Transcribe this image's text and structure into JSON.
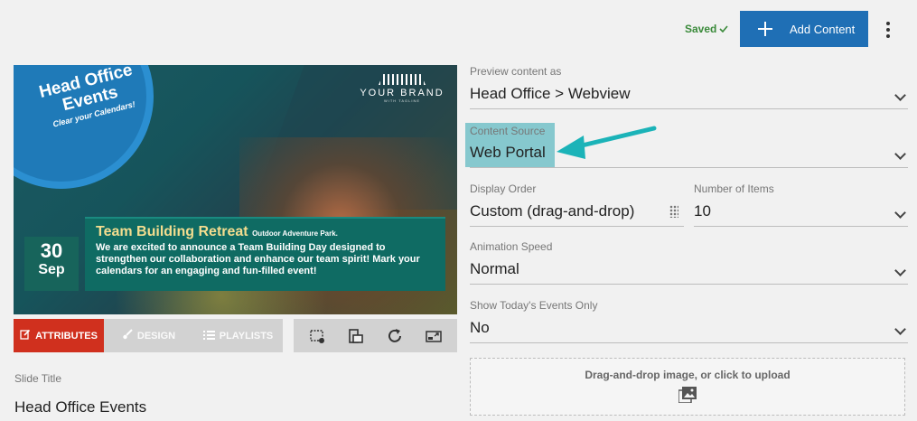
{
  "header": {
    "saved_label": "Saved",
    "saved_icon": "check-icon",
    "add_content_label": "Add Content",
    "add_icon": "plus-icon",
    "more_icon": "kebab-menu-icon",
    "accent_color": "#1f6fb5"
  },
  "preview": {
    "badge_title_line1": "Head Office",
    "badge_title_line2": "Events",
    "badge_subtitle": "Clear your Calendars!",
    "brand_name": "YOUR BRAND",
    "brand_tagline": "WITH TAGLINE",
    "date_day": "30",
    "date_month": "Sep",
    "event_title": "Team Building Retreat",
    "event_location": "Outdoor Adventure Park.",
    "event_body": "We are excited to announce a Team Building Day designed to strengthen our collaboration and enhance our team spirit! Mark your calendars for an engaging and fun-filled event!"
  },
  "tabs": [
    {
      "label": "ATTRIBUTES",
      "icon": "edit-icon",
      "active": true
    },
    {
      "label": "DESIGN",
      "icon": "brush-icon",
      "active": false
    },
    {
      "label": "PLAYLISTS",
      "icon": "list-icon",
      "active": false
    }
  ],
  "tools": [
    {
      "icon": "crop-icon"
    },
    {
      "icon": "layers-icon"
    },
    {
      "icon": "refresh-icon"
    },
    {
      "icon": "resize-icon"
    }
  ],
  "slide": {
    "title_label": "Slide Title",
    "title_value": "Head Office Events"
  },
  "form": {
    "preview_as_label": "Preview content as",
    "preview_as_value": "Head Office > Webview",
    "content_source_label": "Content Source",
    "content_source_value": "Web Portal",
    "display_order_label": "Display Order",
    "display_order_value": "Custom (drag-and-drop)",
    "num_items_label": "Number of Items",
    "num_items_value": "10",
    "animation_speed_label": "Animation Speed",
    "animation_speed_value": "Normal",
    "today_only_label": "Show Today's Events Only",
    "today_only_value": "No",
    "upload_label": "Drag-and-drop image, or click to upload",
    "upload_icon": "image-upload-icon"
  }
}
